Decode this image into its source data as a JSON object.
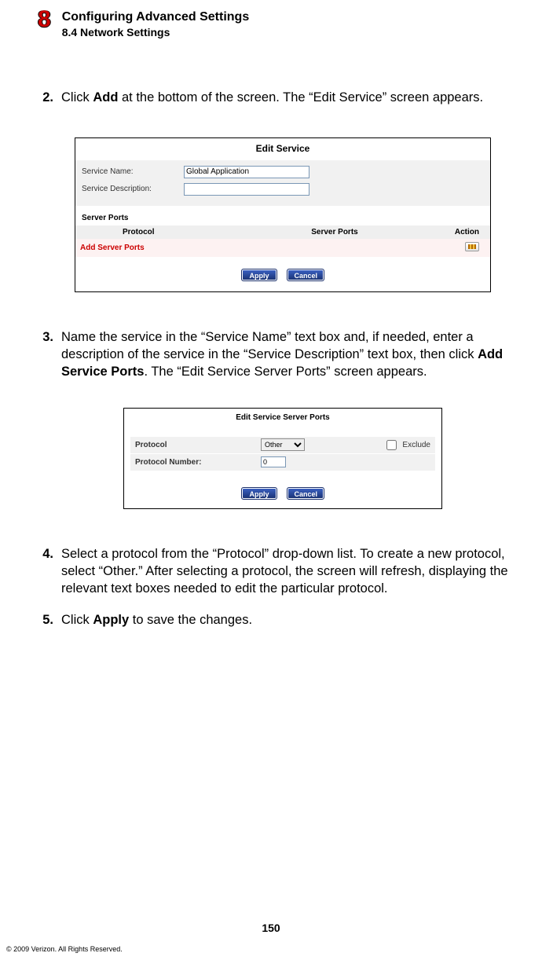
{
  "header": {
    "chapter_number": "8",
    "chapter_title": "Configuring Advanced Settings",
    "section_title": "8.4  Network Settings"
  },
  "steps": {
    "s2": {
      "n": "2.",
      "pre": "Click ",
      "bold": "Add",
      "post": " at the bottom of the screen. The “Edit Service” screen appears."
    },
    "s3": {
      "n": "3.",
      "pre": "Name the service in the “Service Name” text box and, if needed, enter a description of the service in the “Service Description” text box, then click ",
      "bold": "Add Service Ports",
      "post": ". The “Edit Service Server Ports” screen appears."
    },
    "s4": {
      "n": "4.",
      "text": "Select a protocol from the “Protocol” drop-down list. To create a new protocol, select “Other.” After selecting a protocol, the screen will refresh, displaying the relevant text boxes needed to edit the particular protocol."
    },
    "s5": {
      "n": "5.",
      "pre": "Click ",
      "bold": "Apply",
      "post": " to save the changes."
    }
  },
  "shot1": {
    "title": "Edit Service",
    "row1_label": "Service Name:",
    "row1_value": "Global Application",
    "row2_label": "Service Description:",
    "row2_value": "",
    "server_ports_heading": "Server Ports",
    "th_protocol": "Protocol",
    "th_ports": "Server Ports",
    "th_action": "Action",
    "add_row_label": "Add Server Ports",
    "btn_apply": "Apply",
    "btn_cancel": "Cancel"
  },
  "shot2": {
    "title": "Edit Service Server Ports",
    "row1_label": "Protocol",
    "row1_select": "Other",
    "row1_exclude": "Exclude",
    "row2_label": "Protocol Number:",
    "row2_value": "0",
    "btn_apply": "Apply",
    "btn_cancel": "Cancel"
  },
  "footer": {
    "page_number": "150",
    "copyright": "© 2009 Verizon. All Rights Reserved."
  }
}
